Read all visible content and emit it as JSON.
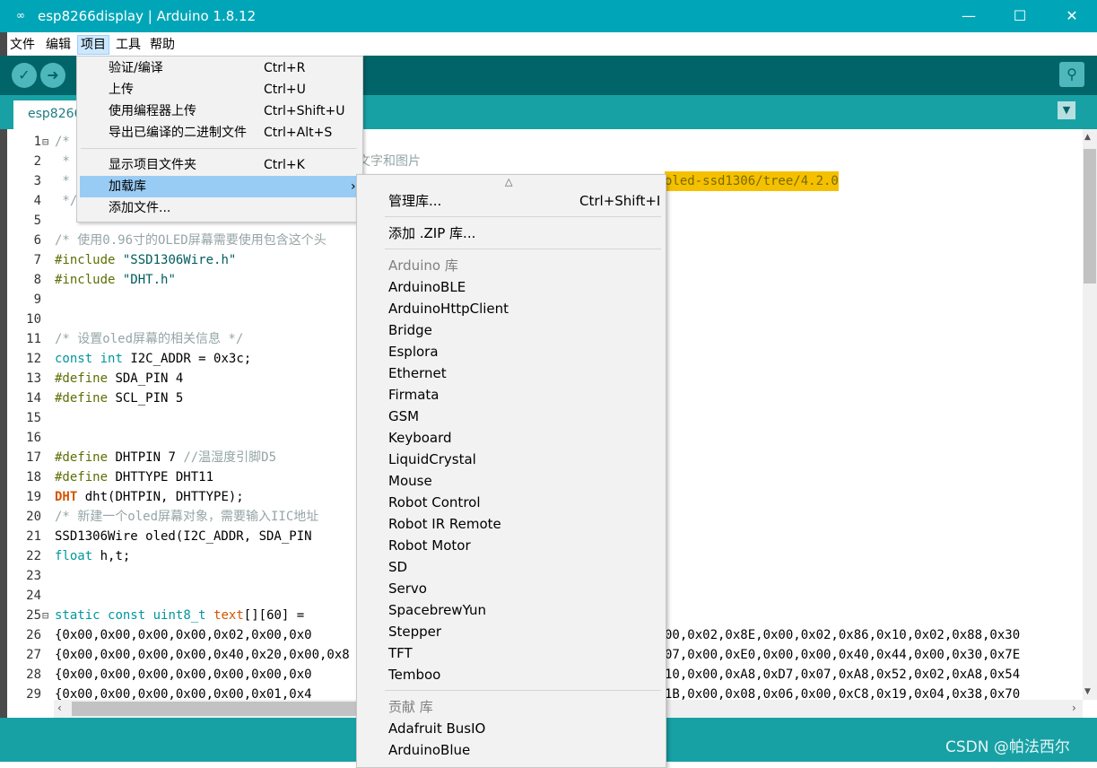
{
  "window": {
    "title": "esp8266display | Arduino 1.8.12",
    "app_icon": "infinity-icon"
  },
  "menubar": [
    "文件",
    "编辑",
    "项目",
    "工具",
    "帮助"
  ],
  "tab": {
    "label": "esp8266"
  },
  "project_menu": [
    {
      "label": "验证/编译",
      "shortcut": "Ctrl+R"
    },
    {
      "label": "上传",
      "shortcut": "Ctrl+U"
    },
    {
      "label": "使用编程器上传",
      "shortcut": "Ctrl+Shift+U"
    },
    {
      "label": "导出已编译的二进制文件",
      "shortcut": "Ctrl+Alt+S"
    },
    {
      "label": "显示项目文件夹",
      "shortcut": "Ctrl+K"
    },
    {
      "label": "加载库",
      "shortcut": "›"
    },
    {
      "label": "添加文件...",
      "shortcut": ""
    }
  ],
  "library_menu": {
    "scroll_up": "△",
    "manage": {
      "label": "管理库...",
      "shortcut": "Ctrl+Shift+I"
    },
    "add_zip": "添加 .ZIP 库...",
    "arduino_header": "Arduino 库",
    "arduino_libs": [
      "ArduinoBLE",
      "ArduinoHttpClient",
      "Bridge",
      "Esplora",
      "Ethernet",
      "Firmata",
      "GSM",
      "Keyboard",
      "LiquidCrystal",
      "Mouse",
      "Robot Control",
      "Robot IR Remote",
      "Robot Motor",
      "SD",
      "Servo",
      "SpacebrewYun",
      "Stepper",
      "TFT",
      "Temboo"
    ],
    "contrib_header": "贡献 库",
    "contrib_libs": [
      "Adafruit BusIO",
      "ArduinoBlue"
    ]
  },
  "editor": {
    "line_numbers": [
      "1",
      "2",
      "3",
      "4",
      "5",
      "6",
      "7",
      "8",
      "9",
      "10",
      "11",
      "12",
      "13",
      "14",
      "15",
      "16",
      "17",
      "18",
      "19",
      "20",
      "21",
      "22",
      "23",
      "24",
      "25",
      "26",
      "27",
      "28",
      "29"
    ],
    "lines": {
      "l1": "/*",
      "l2": " *",
      "l2b": "文字和图片",
      "l3": " *",
      "l3b": "oled-ssd1306/tree/4.2.0",
      "l4": " */",
      "l6": "/* 使用0.96寸的OLED屏幕需要使用包含这个头",
      "l7a": "#include",
      "l7b": "\"SSD1306Wire.h\"",
      "l8a": "#include",
      "l8b": "\"DHT.h\"",
      "l11": "/* 设置oled屏幕的相关信息 */",
      "l12a": "const",
      "l12b": "int",
      "l12c": " I2C_ADDR = 0x3c;",
      "l13a": "#define",
      "l13b": " SDA_PIN 4",
      "l14a": "#define",
      "l14b": " SCL_PIN 5",
      "l17a": "#define",
      "l17b": " DHTPIN 7 ",
      "l17c": "//温湿度引脚D5",
      "l18a": "#define",
      "l18b": " DHTTYPE DHT11",
      "l19a": "DHT",
      "l19b": " dht(DHTPIN, DHTTYPE);",
      "l20": "/* 新建一个oled屏幕对象，需要输入IIC地址",
      "l21": "SSD1306Wire oled(I2C_ADDR, SDA_PIN",
      "l22a": "float",
      "l22b": " h,t;",
      "l25a": "static",
      "l25b": "const",
      "l25c": "uint8_t",
      "l25d": "text",
      "l25e": "[][60] =",
      "l26a": "{0x00,0x00,0x00,0x00,0x02,0x00,0x0",
      "l26b": "00,0x02,0x8E,0x00,0x02,0x86,0x10,0x02,0x88,0x30",
      "l27a": "{0x00,0x00,0x00,0x00,0x40,0x20,0x00,0x8",
      "l27b": "07,0x00,0xE0,0x00,0x00,0x40,0x44,0x00,0x30,0x7E",
      "l28a": "{0x00,0x00,0x00,0x00,0x00,0x00,0x0",
      "l28b": "10,0x00,0xA8,0xD7,0x07,0xA8,0x52,0x02,0xA8,0x54",
      "l29a": "{0x00,0x00,0x00,0x00,0x00,0x01,0x4",
      "l29b": "1B,0x00,0x08,0x06,0x00,0xC8,0x19,0x04,0x38,0x70"
    }
  },
  "watermark": "CSDN @帕法西尔",
  "colors": {
    "titlebar": "#00a6b8",
    "toolbar": "#006468",
    "tabbar": "#17a1a5",
    "highlight": "#f5c000"
  }
}
